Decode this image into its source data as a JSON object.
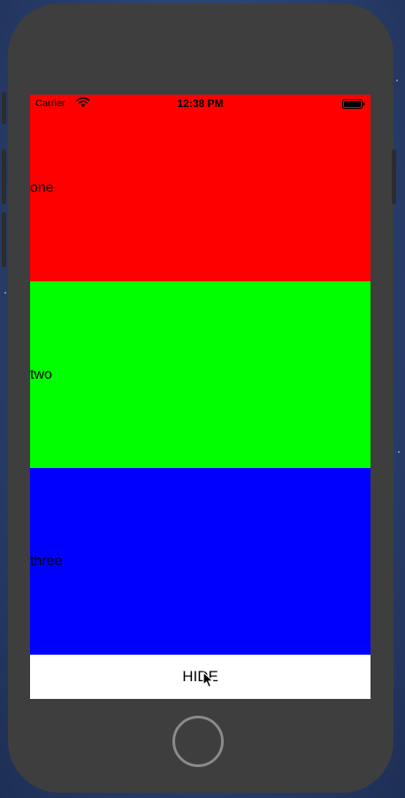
{
  "status_bar": {
    "carrier": "Carrier",
    "time": "12:38 PM"
  },
  "rows": [
    {
      "label": "one",
      "color": "#ff0000"
    },
    {
      "label": "two",
      "color": "#00ff00"
    },
    {
      "label": "three",
      "color": "#0000ff"
    }
  ],
  "hide_button": {
    "label": "HIDE"
  },
  "colors": {
    "device_body": "#3e3e3e",
    "screen_background": "#ffffff"
  }
}
